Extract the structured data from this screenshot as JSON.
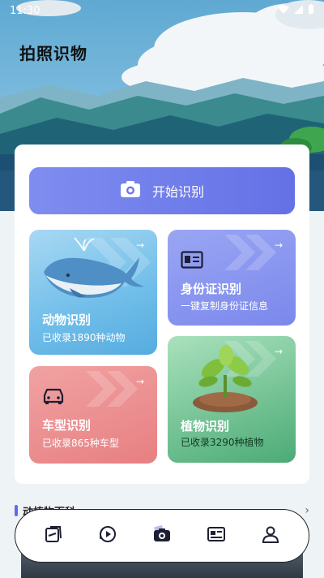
{
  "status_bar": {
    "time": "11:30"
  },
  "page_title": "拍照识物",
  "start_button": {
    "label": "开始识别",
    "icon": "camera-icon"
  },
  "tiles": {
    "animal": {
      "title": "动物识别",
      "subtitle": "已收录1890种动物",
      "icon": "whale-illustration"
    },
    "id_card": {
      "title": "身份证识别",
      "subtitle": "一键复制身份证信息",
      "icon": "id-card-icon"
    },
    "car": {
      "title": "车型识别",
      "subtitle": "已收录865种车型",
      "icon": "car-icon"
    },
    "plant": {
      "title": "植物识别",
      "subtitle": "已收录3290种植物",
      "icon": "plant-illustration"
    }
  },
  "section": {
    "label": "动植物百科",
    "more": "›"
  },
  "tabbar": {
    "items": [
      {
        "icon": "album-icon"
      },
      {
        "icon": "video-icon"
      },
      {
        "icon": "camera-icon",
        "active": true
      },
      {
        "icon": "document-icon"
      },
      {
        "icon": "profile-icon"
      }
    ]
  },
  "colors": {
    "accent": "#6471e6",
    "animal": "#6fbde9",
    "id": "#7b88ec",
    "car": "#e77f82",
    "plant": "#4cab76"
  }
}
